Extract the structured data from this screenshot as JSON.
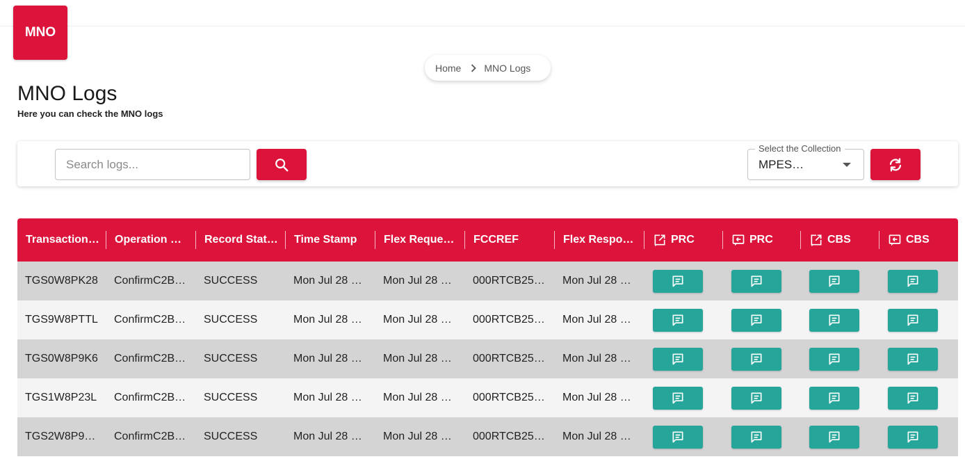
{
  "brand": {
    "logo_text": "MNO",
    "accent_color": "#dc143c",
    "action_color": "#26a69a"
  },
  "breadcrumb": {
    "home": "Home",
    "current": "MNO Logs"
  },
  "page": {
    "title": "MNO Logs",
    "subtitle": "Here you can check the MNO logs"
  },
  "search": {
    "placeholder": "Search logs...",
    "value": "",
    "button_icon": "search-icon"
  },
  "collection": {
    "label": "Select the Collection",
    "value": "MPES…",
    "refresh_icon": "refresh-icon"
  },
  "table": {
    "columns": [
      {
        "label": "Transaction Id"
      },
      {
        "label": "Operation N…"
      },
      {
        "label": "Record Status"
      },
      {
        "label": "Time Stamp"
      },
      {
        "label": "Flex Reque…"
      },
      {
        "label": "FCCREF"
      },
      {
        "label": "Flex Respo…"
      },
      {
        "label": "PRC",
        "icon": "outgoing-message-icon"
      },
      {
        "label": "PRC",
        "icon": "incoming-message-icon"
      },
      {
        "label": "CBS",
        "icon": "outgoing-message-icon"
      },
      {
        "label": "CBS",
        "icon": "incoming-message-icon"
      }
    ],
    "action_icon": "message-icon",
    "rows": [
      {
        "transaction_id": "TGS0W8PK28",
        "operation": "ConfirmC2B…",
        "status": "SUCCESS",
        "timestamp": "Mon Jul 28 …",
        "flex_request": "Mon Jul 28 …",
        "fccref": "000RTCB25…",
        "flex_response": "Mon Jul 28 …"
      },
      {
        "transaction_id": "TGS9W8PTTL",
        "operation": "ConfirmC2B…",
        "status": "SUCCESS",
        "timestamp": "Mon Jul 28 …",
        "flex_request": "Mon Jul 28 …",
        "fccref": "000RTCB25…",
        "flex_response": "Mon Jul 28 …"
      },
      {
        "transaction_id": "TGS0W8P9K6",
        "operation": "ConfirmC2B…",
        "status": "SUCCESS",
        "timestamp": "Mon Jul 28 …",
        "flex_request": "Mon Jul 28 …",
        "fccref": "000RTCB25…",
        "flex_response": "Mon Jul 28 …"
      },
      {
        "transaction_id": "TGS1W8P23L",
        "operation": "ConfirmC2B…",
        "status": "SUCCESS",
        "timestamp": "Mon Jul 28 …",
        "flex_request": "Mon Jul 28 …",
        "fccref": "000RTCB25…",
        "flex_response": "Mon Jul 28 …"
      },
      {
        "transaction_id": "TGS2W8P9…",
        "operation": "ConfirmC2B…",
        "status": "SUCCESS",
        "timestamp": "Mon Jul 28 …",
        "flex_request": "Mon Jul 28 …",
        "fccref": "000RTCB25…",
        "flex_response": "Mon Jul 28 …"
      }
    ]
  }
}
